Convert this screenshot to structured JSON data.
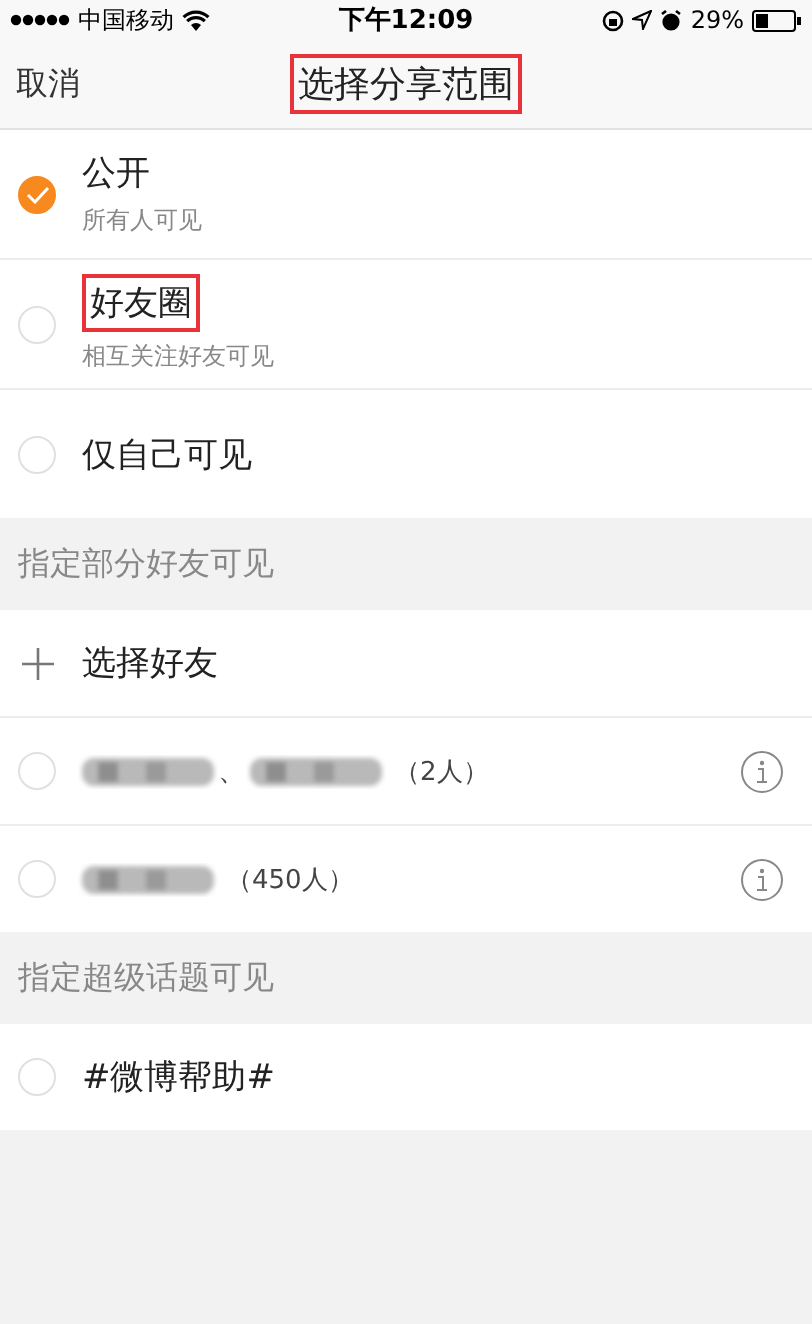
{
  "status_bar": {
    "carrier": "中国移动",
    "time": "下午12:09",
    "battery": "29%"
  },
  "nav": {
    "cancel": "取消",
    "title": "选择分享范围",
    "title_highlighted": true
  },
  "options": [
    {
      "label": "公开",
      "subtitle": "所有人可见",
      "selected": true,
      "highlighted": false
    },
    {
      "label": "好友圈",
      "subtitle": "相互关注好友可见",
      "selected": false,
      "highlighted": true
    },
    {
      "label": "仅自己可见",
      "selected": false,
      "highlighted": false
    }
  ],
  "sections": [
    {
      "header": "指定部分好友可见",
      "items": [
        {
          "kind": "add",
          "label": "选择好友"
        },
        {
          "kind": "group",
          "segments": [
            {
              "kind": "blur"
            },
            {
              "kind": "text",
              "text": "、"
            },
            {
              "kind": "blur"
            }
          ],
          "count": "（2人）",
          "selected": false
        },
        {
          "kind": "group",
          "segments": [
            {
              "kind": "blur"
            }
          ],
          "count": "（450人）",
          "selected": false
        }
      ]
    },
    {
      "header": "指定超级话题可见",
      "items": [
        {
          "kind": "topic",
          "label": "#微博帮助#",
          "selected": false
        }
      ]
    }
  ]
}
